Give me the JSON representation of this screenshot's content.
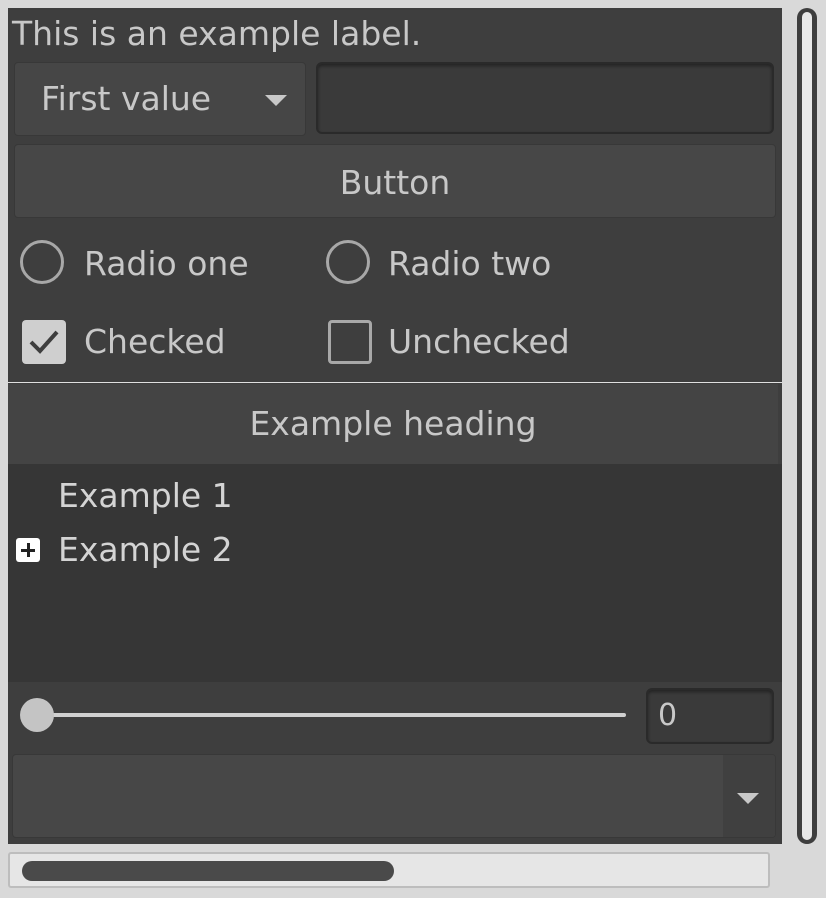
{
  "label": {
    "text": "This is an example label."
  },
  "combo": {
    "selected": "First value",
    "icon": "chevron-down-icon"
  },
  "text_input": {
    "value": "",
    "placeholder": ""
  },
  "button": {
    "label": "Button"
  },
  "radios": [
    {
      "label": "Radio one",
      "selected": false
    },
    {
      "label": "Radio two",
      "selected": false
    }
  ],
  "checkboxes": [
    {
      "label": "Checked",
      "checked": true
    },
    {
      "label": "Unchecked",
      "checked": false
    }
  ],
  "heading": {
    "text": "Example heading"
  },
  "tree": {
    "items": [
      {
        "label": "Example 1",
        "expandable": false
      },
      {
        "label": "Example 2",
        "expandable": true,
        "icon": "expand-plus-icon"
      }
    ]
  },
  "slider": {
    "value": "0"
  },
  "dropdown": {
    "selected": "",
    "icon": "chevron-down-icon"
  },
  "colors": {
    "background": "#3e3e3e",
    "text": "#c8c8c8",
    "tree_background": "#363636"
  }
}
